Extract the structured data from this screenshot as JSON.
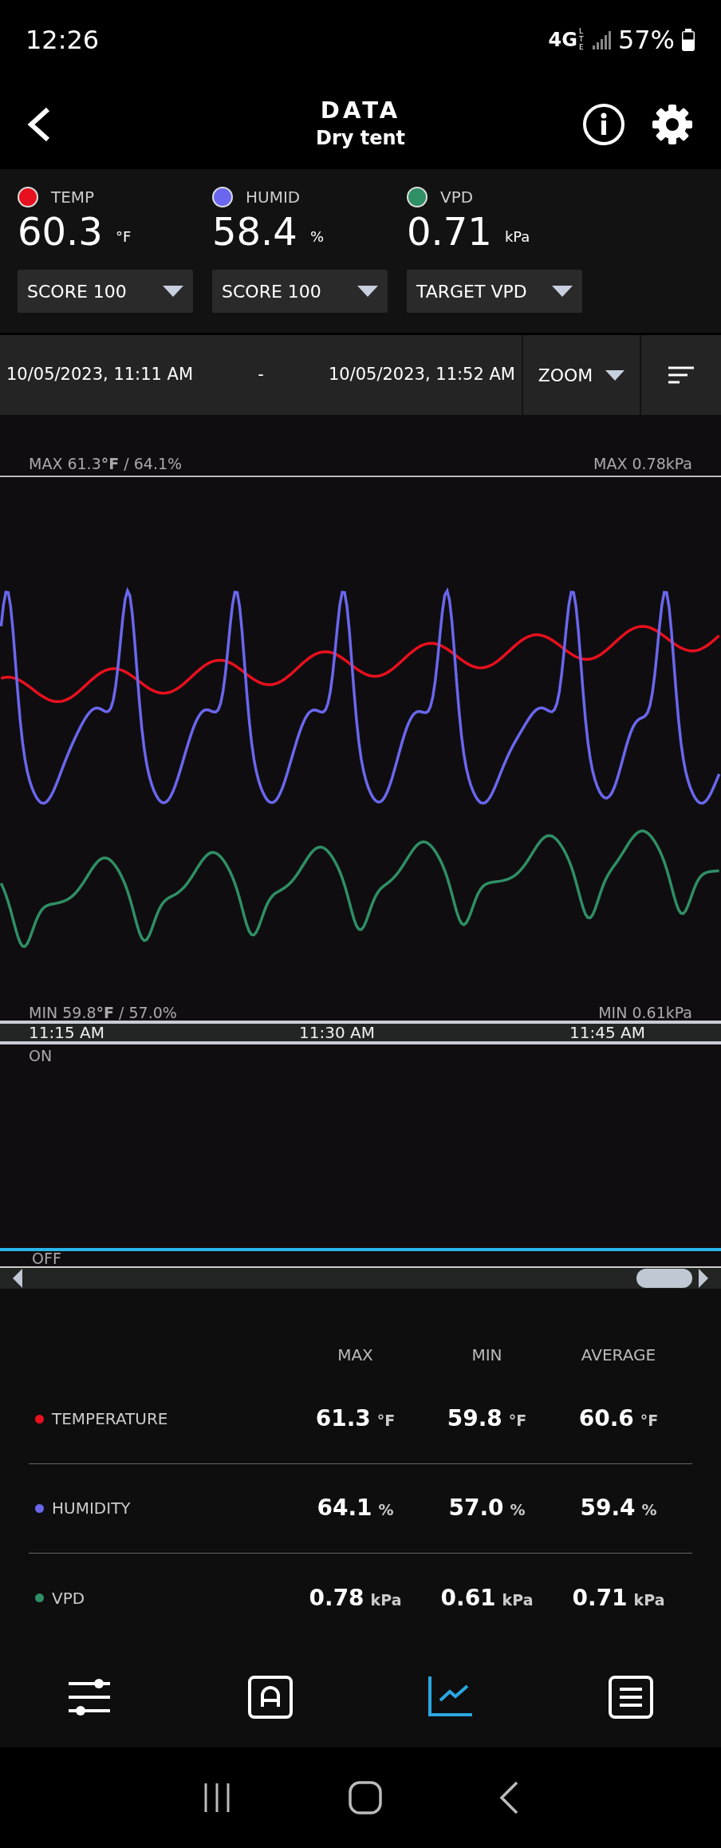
{
  "status_bar": {
    "time": "12:26",
    "network": "4G",
    "network_sub": "LTE",
    "battery": "57%"
  },
  "header": {
    "title": "DATA",
    "subtitle": "Dry tent"
  },
  "sensors": [
    {
      "name": "TEMP",
      "color": "#e8101e",
      "value": "60.3",
      "unit": "°F",
      "dropdown": "SCORE 100"
    },
    {
      "name": "HUMID",
      "color": "#6a67ee",
      "value": "58.4",
      "unit": "%",
      "dropdown": "SCORE 100"
    },
    {
      "name": "VPD",
      "color": "#2f8f65",
      "value": "0.71",
      "unit": "kPa",
      "dropdown": "TARGET VPD"
    }
  ],
  "date_range": {
    "start": "10/05/2023, 11:11 AM",
    "separator": "-",
    "end": "10/05/2023, 11:52 AM",
    "zoom": "ZOOM"
  },
  "chart": {
    "max_left": "MAX 61.3**°F** / 64.1%",
    "max_right": "MAX 0.78kPa",
    "min_left": "MIN 59.8**°F** / 57.0%",
    "min_right": "MIN 0.61kPa",
    "times": [
      "11:15 AM",
      "11:30 AM",
      "11:45 AM"
    ],
    "on_label": "ON",
    "off_label": "OFF"
  },
  "stats": {
    "columns": [
      "MAX",
      "MIN",
      "AVERAGE"
    ],
    "rows": [
      {
        "name": "TEMPERATURE",
        "color": "#e8101e",
        "cells": [
          {
            "value": "61.3",
            "unit": "°F"
          },
          {
            "value": "59.8",
            "unit": "°F"
          },
          {
            "value": "60.6",
            "unit": "°F"
          }
        ]
      },
      {
        "name": "HUMIDITY",
        "color": "#6a67ee",
        "cells": [
          {
            "value": "64.1",
            "unit": "%"
          },
          {
            "value": "57.0",
            "unit": "%"
          },
          {
            "value": "59.4",
            "unit": "%"
          }
        ]
      },
      {
        "name": "VPD",
        "color": "#2f8f65",
        "cells": [
          {
            "value": "0.78",
            "unit": "kPa"
          },
          {
            "value": "0.61",
            "unit": "kPa"
          },
          {
            "value": "0.71",
            "unit": "kPa"
          }
        ]
      }
    ]
  },
  "bottom_nav": [
    {
      "kind": "sliders",
      "selected": false
    },
    {
      "kind": "auto",
      "selected": false
    },
    {
      "kind": "chart",
      "selected": true
    },
    {
      "kind": "list",
      "selected": false
    }
  ]
}
